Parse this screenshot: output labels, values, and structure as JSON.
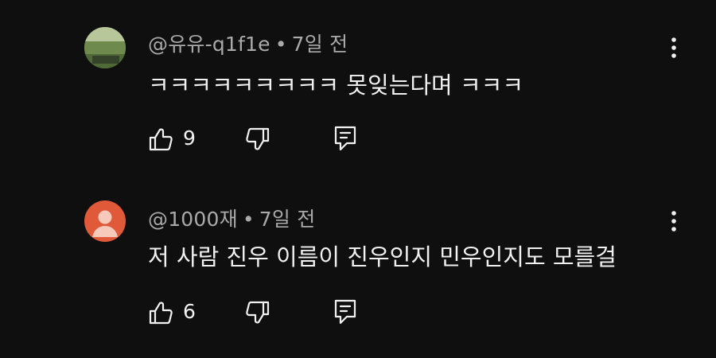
{
  "comments": [
    {
      "author": "@유유-q1f1e",
      "separator": "•",
      "time": "7일 전",
      "text": "ㅋㅋㅋㅋㅋㅋㅋㅋㅋ 못잊는다며 ㅋㅋㅋ",
      "likes": "9",
      "avatar_color": "#7a8f5a"
    },
    {
      "author": "@1000재",
      "separator": "•",
      "time": "7일 전",
      "text": "저 사람 진우 이름이 진우인지 민우인지도 모를걸",
      "likes": "6",
      "avatar_color": "#e05a3a"
    }
  ],
  "icons": {
    "like": "thumbs-up-icon",
    "dislike": "thumbs-down-icon",
    "reply": "reply-icon",
    "more": "more-vertical-icon"
  }
}
